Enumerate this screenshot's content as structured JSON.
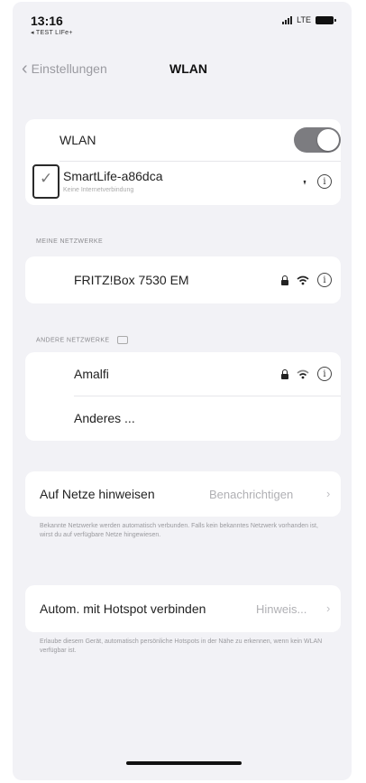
{
  "status_bar": {
    "time": "13:16",
    "back_to_app": "◂ TEST LIFe+",
    "network": "LTE"
  },
  "nav": {
    "back_label": "Einstellungen",
    "title": "WLAN"
  },
  "wlan_card": {
    "wlan_label": "WLAN",
    "wlan_enabled": true,
    "connected_network": "SmartLife-a86dca",
    "connected_subtitle": "Keine Internetverbindung"
  },
  "my_networks": {
    "header": "MEINE NETZWERKE",
    "items": [
      {
        "name": "FRITZ!Box 7530 EM",
        "secured": true
      }
    ]
  },
  "other_networks": {
    "header": "ANDERE NETZWERKE",
    "items": [
      {
        "name": "Amalfi",
        "secured": true
      }
    ],
    "other_label": "Anderes ..."
  },
  "ask_to_join": {
    "label": "Auf Netze hinweisen",
    "value": "Benachrichtigen",
    "footnote": "Bekannte Netzwerke werden automatisch verbunden. Falls kein bekanntes Netzwerk vorhanden ist, wirst du auf verfügbare Netze hingewiesen."
  },
  "auto_hotspot": {
    "label": "Autom. mit Hotspot verbinden",
    "value": "Hinweis...",
    "footnote": "Erlaube diesem Gerät, automatisch persönliche Hotspots in der Nähe zu erkennen, wenn kein WLAN verfügbar ist."
  },
  "colors": {
    "background": "#f2f2f6",
    "toggle_on": "#7c7c80",
    "card": "#ffffff"
  }
}
